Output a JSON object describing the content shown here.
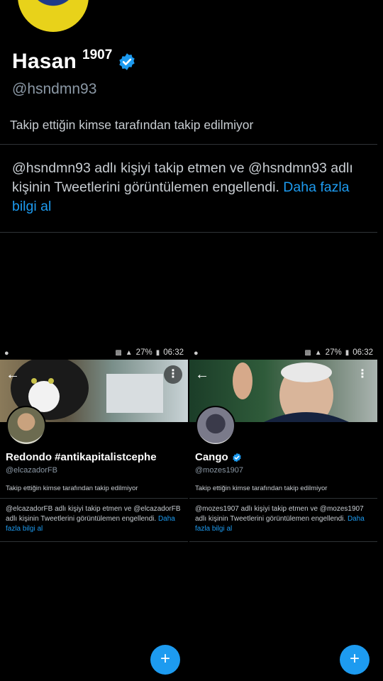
{
  "main_profile": {
    "name": "Hasan",
    "name_suffix": "1907",
    "handle": "@hsndmn93",
    "follow_note": "Takip ettiğin kimse tarafından takip edilmiyor",
    "blocked_text": "@hsndmn93 adlı kişiyi takip etmen ve @hsndmn93 adlı kişinin Tweetlerini görüntülemen engellendi.",
    "learn_more": "Daha fazla bilgi al"
  },
  "status_bar": {
    "battery": "27%",
    "time": "06:32"
  },
  "thumbnails": [
    {
      "name": "Redondo #antikapitalistcephe",
      "handle": "@elcazadorFB",
      "verified": false,
      "follow_note": "Takip ettiğin kimse tarafından takip edilmiyor",
      "blocked_text": "@elcazadorFB adlı kişiyi takip etmen ve @elcazadorFB adlı kişinin Tweetlerini görüntülemen engellendi.",
      "learn_more": "Daha fazla bilgi al"
    },
    {
      "name": "Cango",
      "handle": "@mozes1907",
      "verified": true,
      "follow_note": "Takip ettiğin kimse tarafından takip edilmiyor",
      "blocked_text": "@mozes1907 adlı kişiyi takip etmen ve @mozes1907 adlı kişinin Tweetlerini görüntülemen engellendi.",
      "learn_more": "Daha fazla bilgi al"
    }
  ],
  "icons": {
    "back": "back-arrow-icon",
    "more": "more-vertical-icon",
    "verified": "verified-badge-icon",
    "compose": "plus-icon"
  },
  "colors": {
    "accent": "#1d9bf0",
    "background": "#000000",
    "muted": "#8b98a5"
  },
  "fab_label": "+"
}
